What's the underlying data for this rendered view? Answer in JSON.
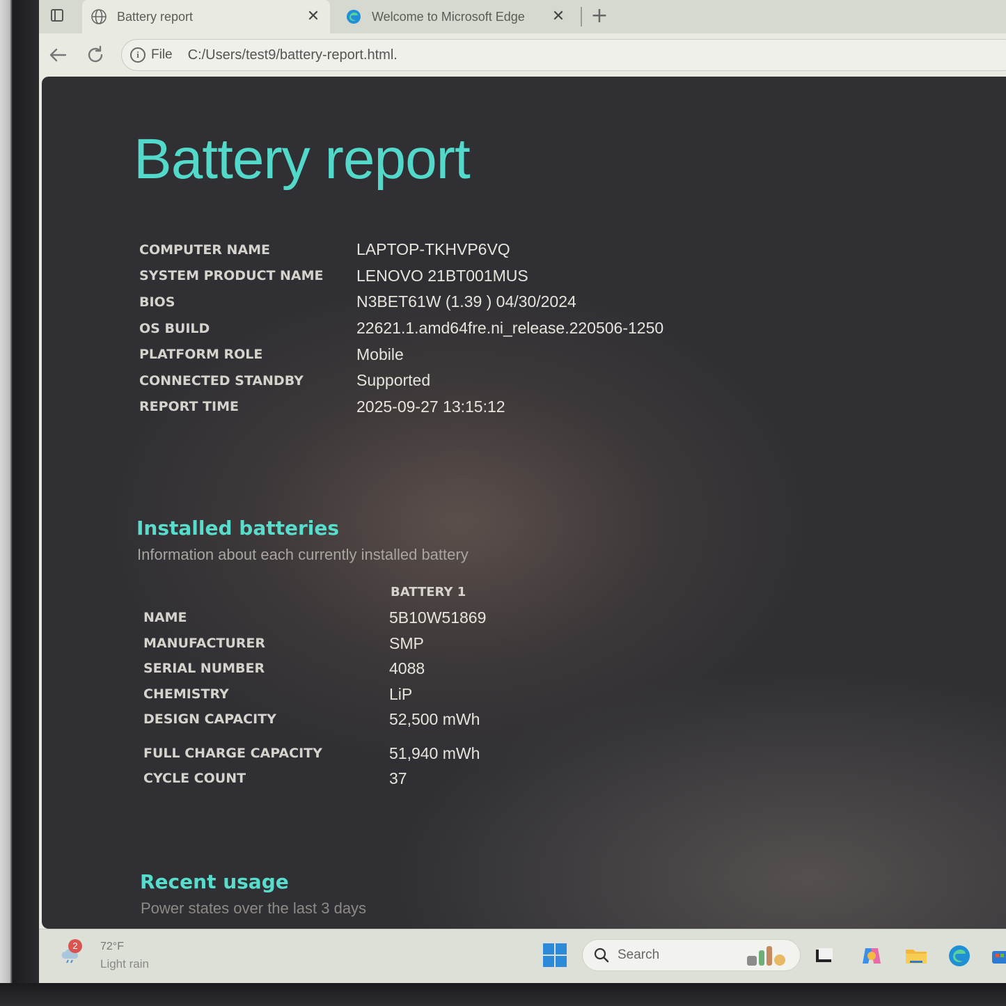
{
  "browser": {
    "tabs": [
      {
        "title": "Battery report",
        "active": true,
        "icon": "globe-icon"
      },
      {
        "title": "Welcome to Microsoft Edge",
        "active": false,
        "icon": "edge-icon"
      }
    ],
    "address": {
      "scheme": "File",
      "url": "C:/Users/test9/battery-report.html."
    }
  },
  "report": {
    "title": "Battery report",
    "system": [
      {
        "label": "COMPUTER NAME",
        "value": "LAPTOP-TKHVP6VQ"
      },
      {
        "label": "SYSTEM PRODUCT NAME",
        "value": "LENOVO 21BT001MUS"
      },
      {
        "label": "BIOS",
        "value": "N3BET61W (1.39 ) 04/30/2024"
      },
      {
        "label": "OS BUILD",
        "value": "22621.1.amd64fre.ni_release.220506-1250"
      },
      {
        "label": "PLATFORM ROLE",
        "value": "Mobile"
      },
      {
        "label": "CONNECTED STANDBY",
        "value": "Supported"
      },
      {
        "label": "REPORT TIME",
        "value": "2025-09-27  13:15:12"
      }
    ],
    "installed": {
      "heading": "Installed batteries",
      "subheading": "Information about each currently installed battery",
      "column": "BATTERY 1",
      "rows": [
        {
          "label": "NAME",
          "value": "5B10W51869"
        },
        {
          "label": "MANUFACTURER",
          "value": "SMP"
        },
        {
          "label": "SERIAL NUMBER",
          "value": "4088"
        },
        {
          "label": "CHEMISTRY",
          "value": "LiP"
        },
        {
          "label": "DESIGN CAPACITY",
          "value": "52,500 mWh"
        },
        {
          "label": "FULL CHARGE CAPACITY",
          "value": "51,940 mWh"
        },
        {
          "label": "CYCLE COUNT",
          "value": "37"
        }
      ]
    },
    "recent": {
      "heading": "Recent usage",
      "subheading": "Power states over the last 3 days"
    }
  },
  "taskbar": {
    "weather": {
      "badge": "2",
      "temp": "72°F",
      "condition": "Light rain"
    },
    "search_label": "Search"
  },
  "colors": {
    "accent": "#53d9c9",
    "page_bg": "#2f2f34"
  }
}
